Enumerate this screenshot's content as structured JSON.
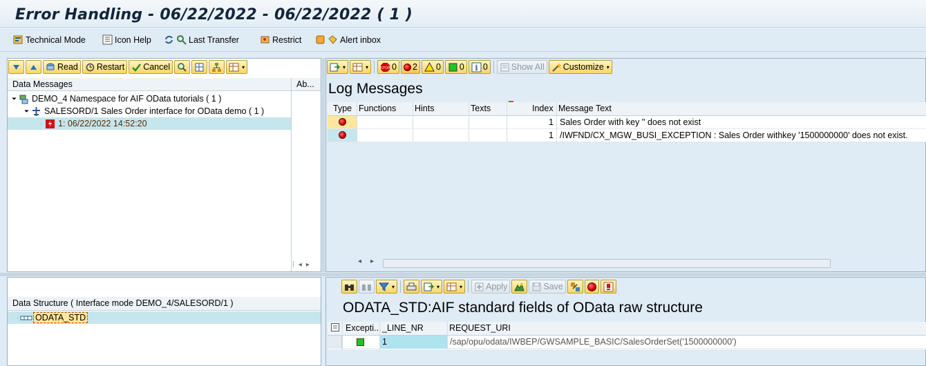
{
  "window": {
    "title": "Error Handling - 06/22/2022 - 06/22/2022 ( 1 )"
  },
  "app_toolbar": [
    {
      "label": "Technical Mode",
      "icon": "technical-mode-icon"
    },
    {
      "label": "Icon Help",
      "icon": "icon-help-icon"
    },
    {
      "label": "Last Transfer",
      "icon": "last-transfer-icon"
    },
    {
      "label": "Restrict",
      "icon": "restrict-icon"
    },
    {
      "label": "Alert inbox",
      "icon": "alert-inbox-icon"
    }
  ],
  "left_toolbar": {
    "read": "Read",
    "restart": "Restart",
    "cancel": "Cancel"
  },
  "data_messages": {
    "col_main": "Data Messages",
    "col_ab": "Ab...",
    "rows": [
      {
        "text": "DEMO_4 Namespace for AIF OData tutorials ( 1 )"
      },
      {
        "text": "SALESORD/1 Sales Order interface for OData demo ( 1 )"
      },
      {
        "text": "1: 06/22/2022 14:52:20"
      }
    ]
  },
  "log_toolbar": {
    "stop_count": "0",
    "error_count": "2",
    "warning_count": "0",
    "success_count": "0",
    "info_count": "0",
    "show_all": "Show All",
    "customize": "Customize"
  },
  "log_messages": {
    "title": "Log Messages",
    "columns": {
      "type": "Type",
      "functions": "Functions",
      "hints": "Hints",
      "texts": "Texts",
      "index": "Index",
      "message": "Message Text"
    },
    "rows": [
      {
        "index": "1",
        "message": "Sales Order with key '' does not exist"
      },
      {
        "index": "1",
        "message": "/IWFND/CX_MGW_BUSI_EXCEPTION : Sales Order withkey '1500000000' does not exist."
      }
    ]
  },
  "data_structure": {
    "header": "Data Structure ( Interface mode DEMO_4/SALESORD/1 )",
    "node": "ODATA_STD"
  },
  "structure_toolbar": {
    "apply": "Apply",
    "save": "Save"
  },
  "structure_detail": {
    "title": "ODATA_STD:AIF standard fields of OData raw structure",
    "columns": {
      "exception": "Excepti...",
      "line_nr": "_LINE_NR",
      "request_uri": "REQUEST_URI"
    },
    "rows": [
      {
        "line_nr": "1",
        "request_uri": "/sap/opu/odata/IWBEP/GWSAMPLE_BASIC/SalesOrderSet('1500000000')"
      }
    ]
  },
  "colors": {
    "selected_row": "#c5e6ed",
    "header_bg": "#eef3f7",
    "accent": "#f6d766",
    "error": "#d40000"
  }
}
